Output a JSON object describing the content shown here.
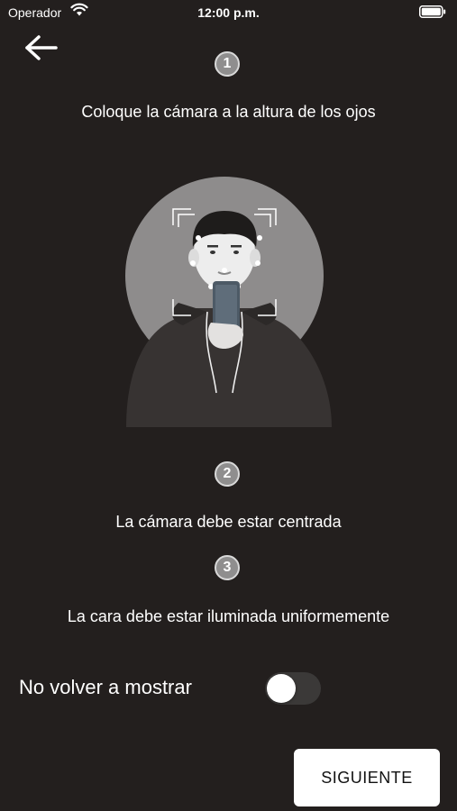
{
  "status_bar": {
    "carrier": "Operador",
    "time": "12:00 p.m.",
    "wifi_icon": "wifi-icon",
    "battery_icon": "battery-icon"
  },
  "nav": {
    "back_icon": "arrow-left-icon"
  },
  "steps": [
    {
      "number": "1",
      "text": "Coloque la cámara a la altura de los ojos"
    },
    {
      "number": "2",
      "text": "La cámara debe estar centrada"
    },
    {
      "number": "3",
      "text": "La cara debe estar iluminada uniformemente"
    }
  ],
  "illustration": {
    "icon": "selfie-face-scan-illustration"
  },
  "dont_show_again": {
    "label": "No volver a mostrar",
    "enabled": false
  },
  "next_button": {
    "label": "SIGUIENTE"
  },
  "colors": {
    "background": "#231f1e",
    "badge": "#8f8e8e",
    "circle": "#8e8c8c",
    "toggle_off": "#3b3938",
    "button": "#ffffff"
  }
}
